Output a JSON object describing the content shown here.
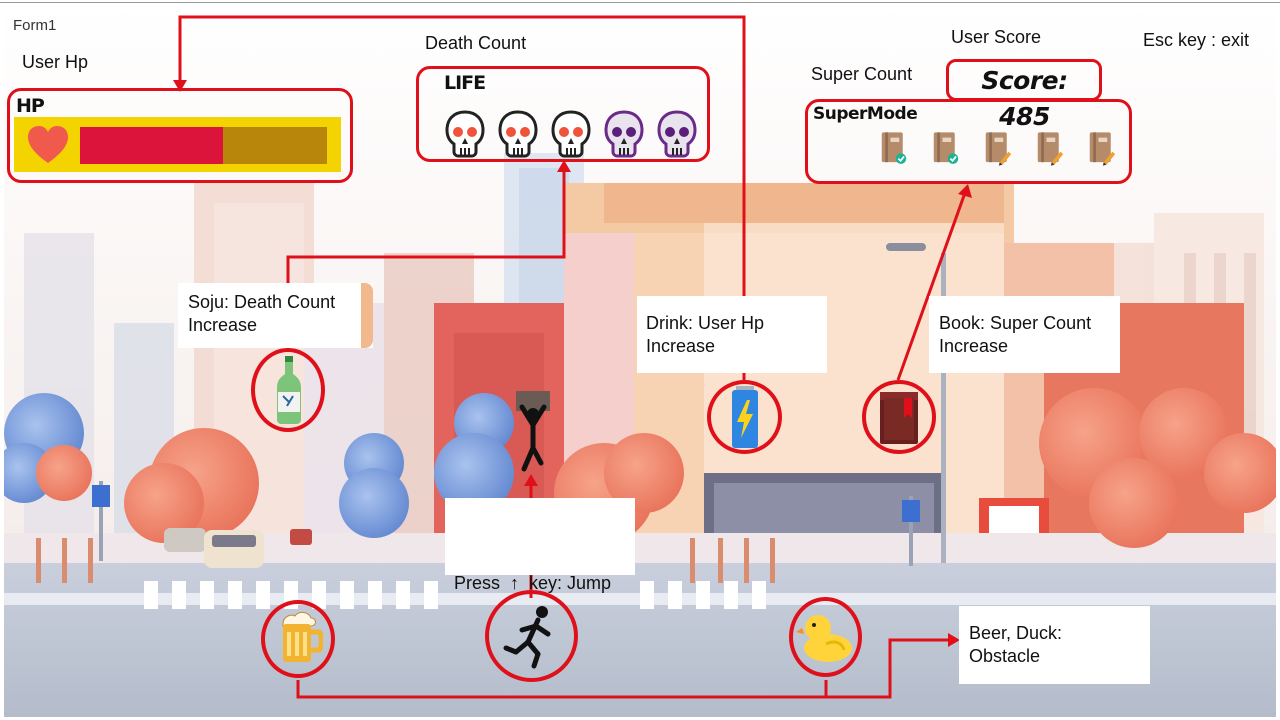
{
  "window": {
    "title": "Form1"
  },
  "labels": {
    "user_hp": "User Hp",
    "death_count": "Death Count",
    "super_count": "Super Count",
    "user_score": "User Score",
    "esc_hint": "Esc key : exit"
  },
  "hud": {
    "hp": {
      "title": "HP",
      "fraction": 0.58
    },
    "life": {
      "title": "LIFE",
      "skulls": [
        "red-eyed-skull",
        "red-eyed-skull",
        "red-eyed-skull",
        "purple-skull",
        "purple-skull"
      ]
    },
    "super_mode": {
      "title": "SuperMode",
      "books": [
        "checked",
        "checked",
        "pencil",
        "pencil",
        "pencil"
      ]
    },
    "score": {
      "text": "Score: 485",
      "value": 485
    }
  },
  "callouts": {
    "soju_line1": "Soju: Death Count",
    "soju_line2": "Increase",
    "drink_line1": "Drink: User Hp",
    "drink_line2": "Increase",
    "book_line1": "Book: Super Count",
    "book_line2": "Increase",
    "jump_line": "Press  ↑  key: Jump",
    "obstacle_line1": "Beer, Duck:",
    "obstacle_line2": "Obstacle"
  },
  "colors": {
    "annotation_red": "#e0101a",
    "hp_fill": "#dc143c",
    "hp_track": "#b8860b",
    "hp_bg": "#f3d300"
  }
}
